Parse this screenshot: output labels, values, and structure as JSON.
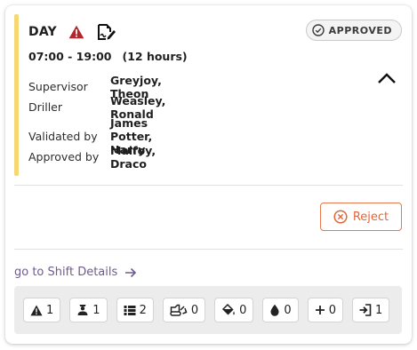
{
  "shift": {
    "title": "DAY",
    "time_range": "07:00 - 19:00",
    "duration": "(12 hours)",
    "status": "APPROVED"
  },
  "people": {
    "supervisor_label": "Supervisor",
    "supervisor": "Greyjoy, Theon",
    "driller_label": "Driller",
    "driller": "Weasley, Ronald",
    "validated_label": "Validated by",
    "validated_by": "James Potter, Harry",
    "approved_label": "Approved by",
    "approved_by": "Malfoy, Draco"
  },
  "actions": {
    "reject_label": "Reject",
    "details_link": "go to Shift Details"
  },
  "counters": [
    {
      "icon": "warning-icon",
      "value": "1"
    },
    {
      "icon": "person-icon",
      "value": "1"
    },
    {
      "icon": "list-icon",
      "value": "2"
    },
    {
      "icon": "drill-rig-icon",
      "value": "0"
    },
    {
      "icon": "paint-bucket-icon",
      "value": "0"
    },
    {
      "icon": "water-drop-icon",
      "value": "0"
    },
    {
      "icon": "plus-icon",
      "value": "0"
    },
    {
      "icon": "sign-in-icon",
      "value": "1"
    }
  ],
  "colors": {
    "accent": "#f5d874",
    "warning": "#b3262b",
    "reject": "#e4653a",
    "link": "#6f5b8f"
  }
}
